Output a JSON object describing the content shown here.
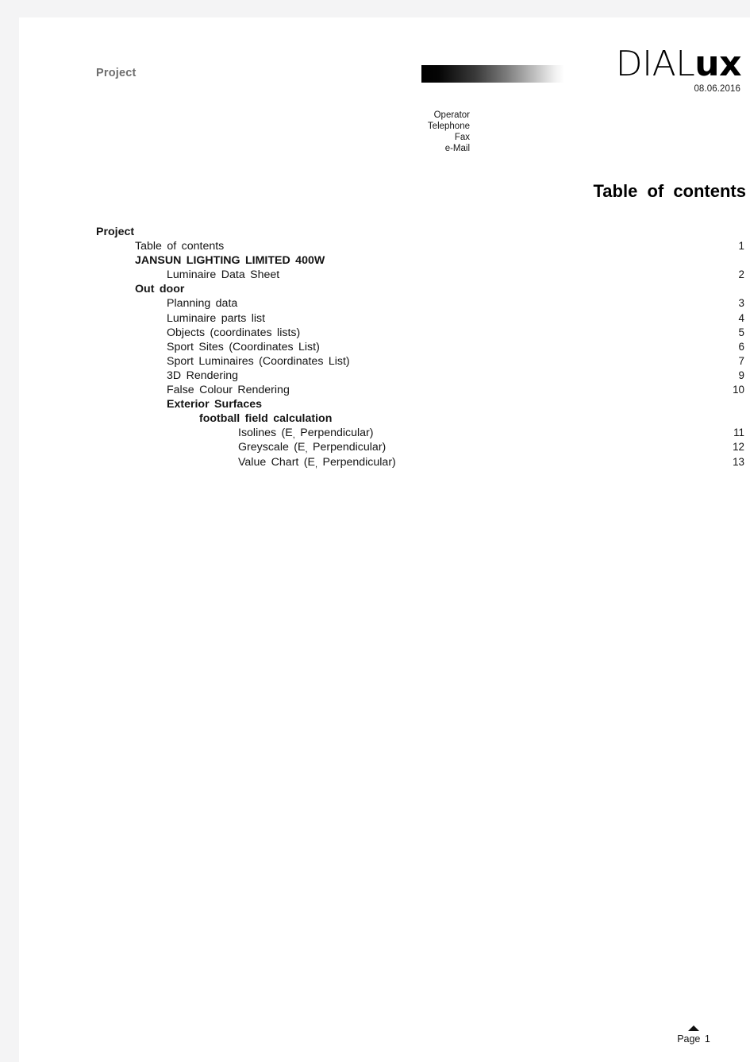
{
  "header": {
    "project_label": "Project",
    "logo_light": "DIAL",
    "logo_bold": "ux",
    "date": "08.06.2016",
    "contact": {
      "operator": "Operator",
      "telephone": "Telephone",
      "fax": "Fax",
      "email": "e-Mail"
    }
  },
  "title": "Table of contents",
  "toc": {
    "entries": [
      {
        "label": "Project",
        "page": "",
        "level": 0,
        "bold": true
      },
      {
        "label": "Table of contents",
        "page": "1",
        "level": 1,
        "bold": false
      },
      {
        "label": "JANSUN LIGHTING LIMITED 400W",
        "page": "",
        "level": 1,
        "bold": true
      },
      {
        "label": "Luminaire Data Sheet",
        "page": "2",
        "level": 2,
        "bold": false
      },
      {
        "label": "Out door",
        "page": "",
        "level": 1,
        "bold": true
      },
      {
        "label": "Planning data",
        "page": "3",
        "level": 2,
        "bold": false
      },
      {
        "label": "Luminaire parts list",
        "page": "4",
        "level": 2,
        "bold": false
      },
      {
        "label": "Objects (coordinates lists)",
        "page": "5",
        "level": 2,
        "bold": false
      },
      {
        "label": "Sport Sites (Coordinates List)",
        "page": "6",
        "level": 2,
        "bold": false
      },
      {
        "label": "Sport Luminaires (Coordinates List)",
        "page": "7",
        "level": 2,
        "bold": false
      },
      {
        "label": "3D Rendering",
        "page": "9",
        "level": 2,
        "bold": false
      },
      {
        "label": "False Colour Rendering",
        "page": "10",
        "level": 2,
        "bold": false
      },
      {
        "label": "Exterior Surfaces",
        "page": "",
        "level": 2,
        "bold": true
      },
      {
        "label": "football field calculation",
        "page": "",
        "level": 3,
        "bold": true
      },
      {
        "label": "Isolines (E, Perpendicular)",
        "page": "11",
        "level": 4,
        "bold": false
      },
      {
        "label": "Greyscale (E, Perpendicular)",
        "page": "12",
        "level": 4,
        "bold": false
      },
      {
        "label": "Value Chart (E, Perpendicular)",
        "page": "13",
        "level": 4,
        "bold": false
      }
    ]
  },
  "footer": {
    "page_label": "Page 1"
  }
}
